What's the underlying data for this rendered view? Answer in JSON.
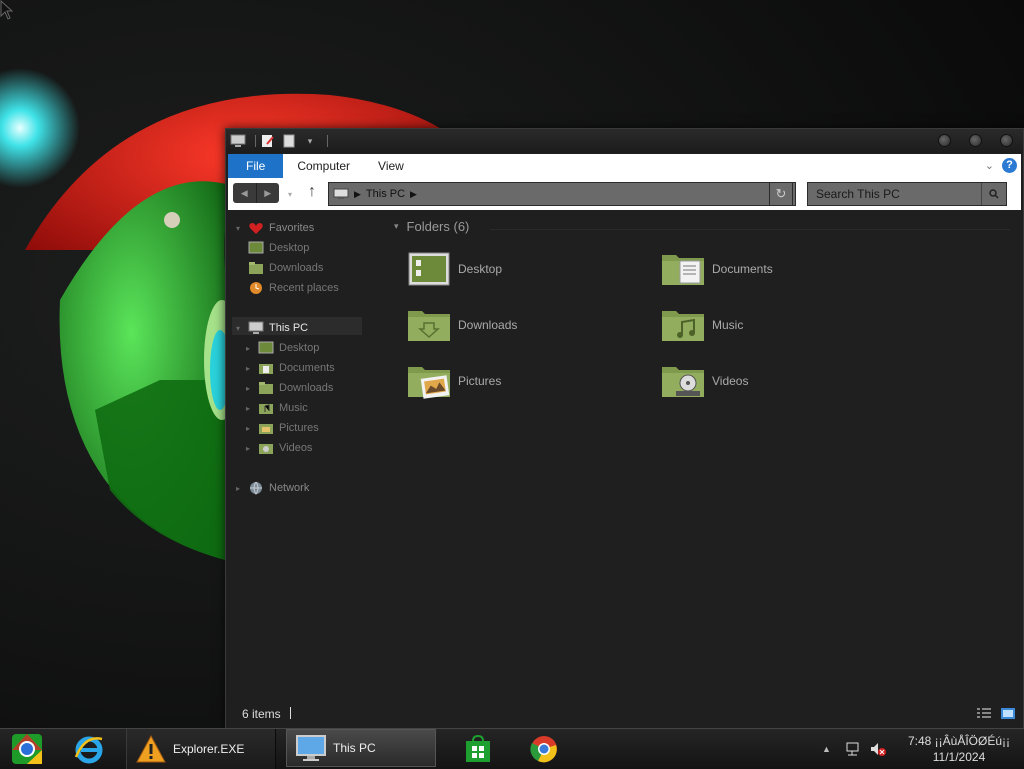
{
  "window": {
    "ribbon_tabs": [
      "File",
      "Computer",
      "View"
    ],
    "address_crumb": "This PC",
    "search_placeholder": "Search This PC"
  },
  "navpane": {
    "favorites": {
      "label": "Favorites",
      "items": [
        "Desktop",
        "Downloads",
        "Recent places"
      ]
    },
    "this_pc": {
      "label": "This PC",
      "items": [
        "Desktop",
        "Documents",
        "Downloads",
        "Music",
        "Pictures",
        "Videos"
      ]
    },
    "network": {
      "label": "Network"
    }
  },
  "content": {
    "group_header": "Folders (6)",
    "folders": [
      {
        "label": "Desktop",
        "icon": "desktop-folder-icon"
      },
      {
        "label": "Documents",
        "icon": "documents-folder-icon"
      },
      {
        "label": "Downloads",
        "icon": "downloads-folder-icon"
      },
      {
        "label": "Music",
        "icon": "music-folder-icon"
      },
      {
        "label": "Pictures",
        "icon": "pictures-folder-icon"
      },
      {
        "label": "Videos",
        "icon": "videos-folder-icon"
      }
    ]
  },
  "status": {
    "items_count": "6 items"
  },
  "taskbar": {
    "buttons": [
      {
        "label": "Explorer.EXE",
        "icon": "warning-icon"
      },
      {
        "label": "This PC",
        "icon": "computer-icon"
      }
    ],
    "clock": {
      "time": "7:48 ¡¡ÂùÅÎÖØÉú¡¡",
      "date": "11/1/2024"
    }
  },
  "colors": {
    "accent": "#1e73c8",
    "folder_green": "#8ca35a",
    "window_bg": "#1f1f1f"
  }
}
